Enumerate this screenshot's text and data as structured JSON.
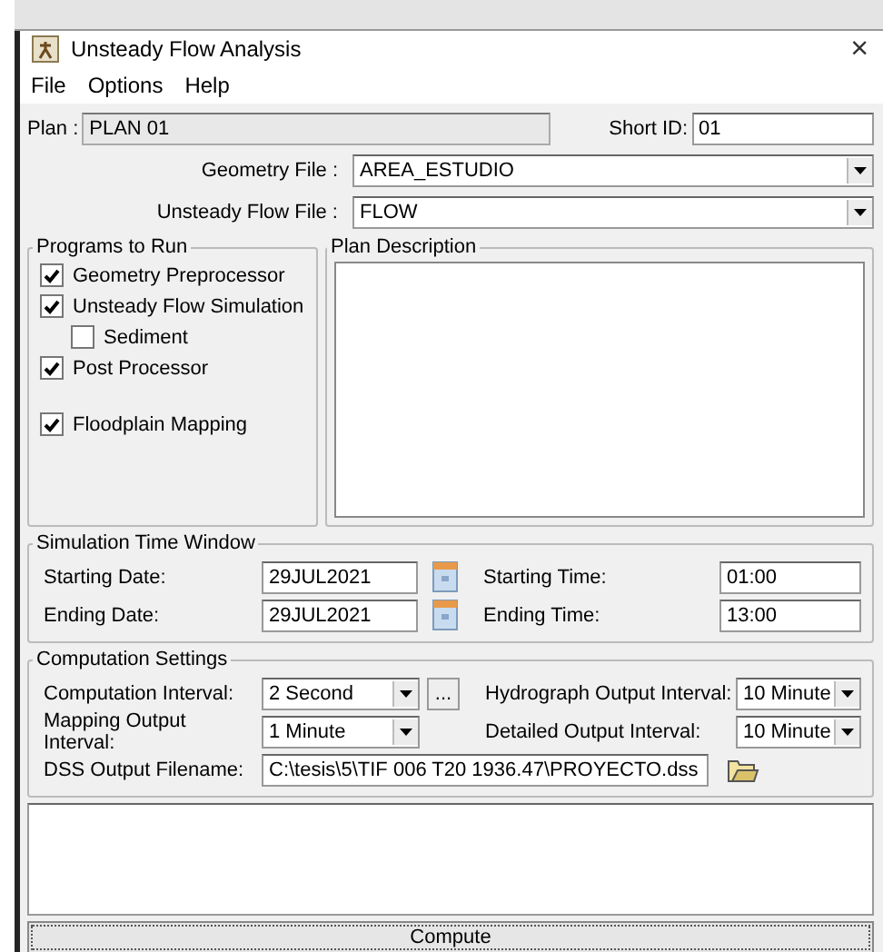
{
  "window": {
    "title": "Unsteady Flow Analysis",
    "close": "×"
  },
  "menu": [
    "File",
    "Options",
    "Help"
  ],
  "plan": {
    "label": "Plan :",
    "value": "PLAN 01",
    "short_id_label": "Short ID:",
    "short_id": "01"
  },
  "files": [
    {
      "label": "Geometry File :",
      "value": "AREA_ESTUDIO"
    },
    {
      "label": "Unsteady Flow File :",
      "value": "FLOW"
    }
  ],
  "programs": {
    "title": "Programs to Run",
    "items": [
      {
        "label": "Geometry Preprocessor",
        "checked": true,
        "kind": "main"
      },
      {
        "label": "Unsteady Flow Simulation",
        "checked": true,
        "kind": "main"
      },
      {
        "label": "Sediment",
        "checked": false,
        "kind": "sub"
      },
      {
        "label": "Post Processor",
        "checked": true,
        "kind": "main"
      },
      {
        "label": "Floodplain Mapping",
        "checked": true,
        "kind": "spaced"
      }
    ]
  },
  "plan_description": {
    "title": "Plan Description"
  },
  "simulation": {
    "title": "Simulation Time Window",
    "rows": [
      {
        "date_label": "Starting Date:",
        "date": "29JUL2021",
        "time_label": "Starting Time:",
        "time": "01:00"
      },
      {
        "date_label": "Ending Date:",
        "date": "29JUL2021",
        "time_label": "Ending Time:",
        "time": "13:00"
      }
    ]
  },
  "computation": {
    "title": "Computation Settings",
    "computation_interval": {
      "label": "Computation Interval:",
      "value": "2 Second",
      "more": "..."
    },
    "hydrograph_interval": {
      "label": "Hydrograph Output Interval:",
      "value": "10 Minute"
    },
    "mapping_interval": {
      "label": "Mapping Output Interval:",
      "value": "1 Minute"
    },
    "detailed_interval": {
      "label": "Detailed Output Interval:",
      "value": "10 Minute"
    },
    "dss": {
      "label": "DSS Output Filename:",
      "value": "C:\\tesis\\5\\TIF 006 T20 1936.47\\PROYECTO.dss"
    }
  },
  "compute_button": "Compute"
}
